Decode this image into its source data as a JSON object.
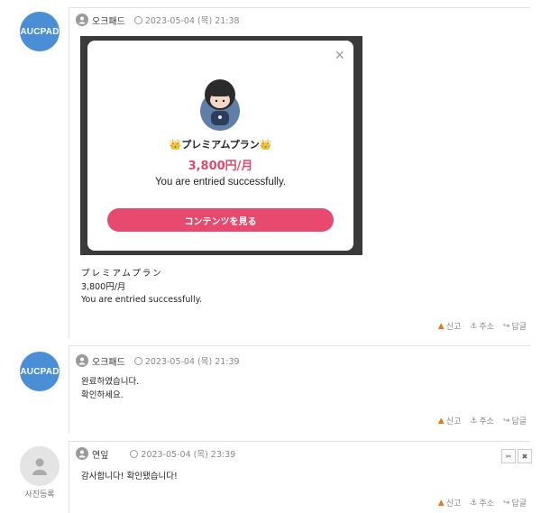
{
  "comments": [
    {
      "avatar_text": "AUCPAD",
      "author": "오크패드",
      "date": "2023-05-04 (목) 21:38",
      "image": {
        "modal_title": "👑プレミアムプラン👑",
        "modal_price": "3,800円/月",
        "modal_message": "You are entried successfully.",
        "modal_button": "コンテンツを見る",
        "close_label": "×"
      },
      "lines": [
        "プレミアムプラン",
        "3,800円/月",
        "You are entried successfully."
      ]
    },
    {
      "avatar_text": "AUCPAD",
      "author": "오크패드",
      "date": "2023-05-04 (목) 21:39",
      "lines": [
        "완료하였습니다.",
        "확인하세요."
      ]
    },
    {
      "author": "연잎",
      "date": "2023-05-04 (목) 23:39",
      "photo_label": "사진등록",
      "lines": [
        "감사합니다! 확인됐습니다!"
      ]
    }
  ],
  "actions": {
    "report": "신고",
    "address": "주소",
    "reply": "답글"
  },
  "admin": {
    "cut": "✂",
    "delete": "✖"
  },
  "colors": {
    "accent": "#e8496e",
    "avatar": "#4a8fd6",
    "warn": "#e07b1f"
  }
}
